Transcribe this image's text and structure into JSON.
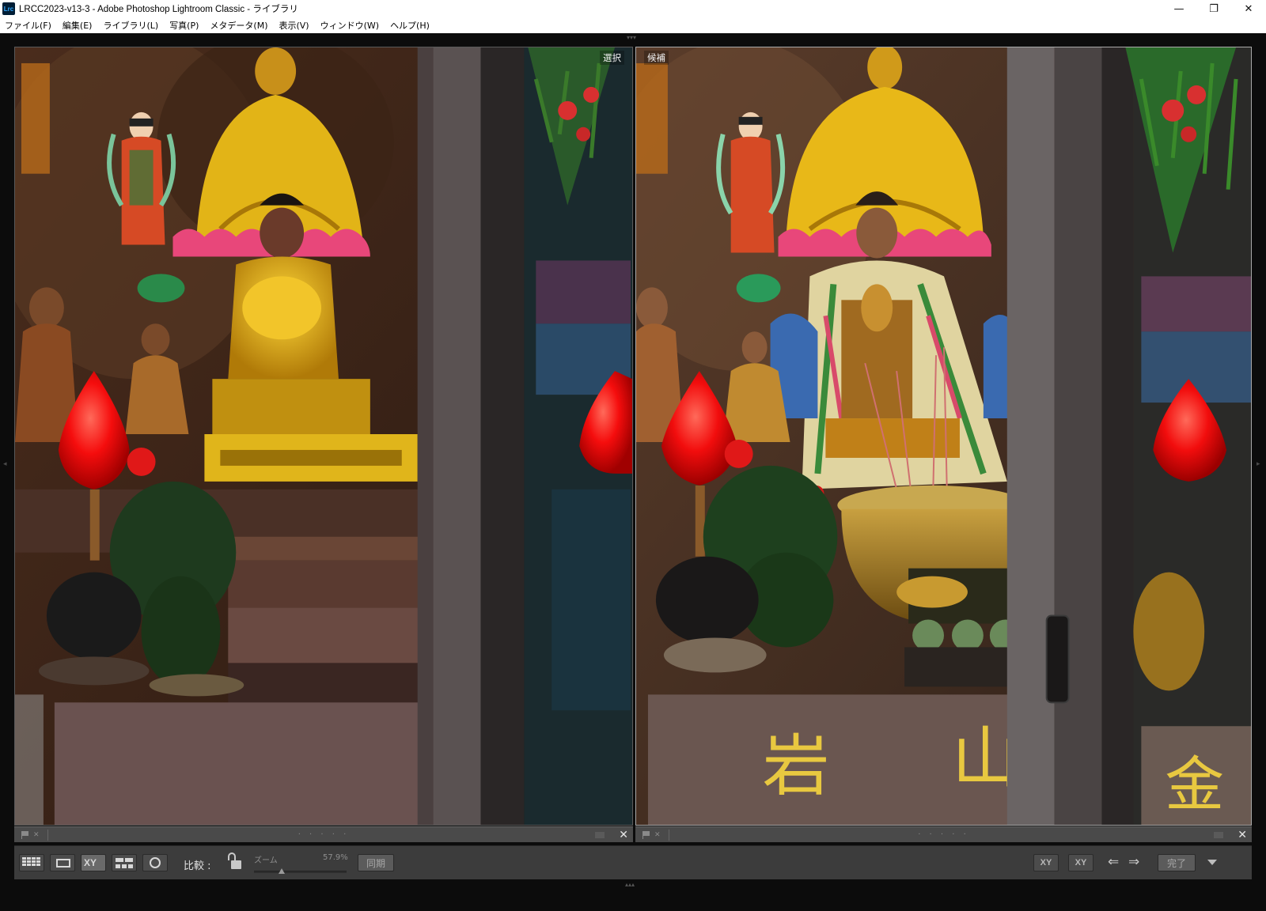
{
  "window": {
    "app_icon_text": "Lrc",
    "title": "LRCC2023-v13-3 - Adobe Photoshop Lightroom Classic - ライブラリ",
    "minimize": "—",
    "maximize": "❐",
    "close": "✕"
  },
  "menu": [
    "ファイル(F)",
    "編集(E)",
    "ライブラリ(L)",
    "写真(P)",
    "メタデータ(M)",
    "表示(V)",
    "ウィンドウ(W)",
    "ヘルプ(H)"
  ],
  "panels": {
    "left": {
      "label": "選択"
    },
    "right": {
      "label": "候補"
    }
  },
  "infostrip": {
    "reject": "✕",
    "dots": "· · · · ·",
    "close": "✕"
  },
  "toolbar": {
    "compare_label": "比較 :",
    "xy_label": "XY",
    "zoom_label": "ズーム",
    "zoom_value": "57.9%",
    "zoom_fraction": 0.3,
    "sync_label": "同期",
    "swap_label": "XY",
    "make_select_label": "XY",
    "prev_arrow": "⇐",
    "next_arrow": "⇒",
    "done_label": "完了"
  },
  "photo_text": {
    "right_char_1": "岩",
    "right_char_2": "山",
    "right_char_3": "金"
  },
  "icons": [
    "grid-view-icon",
    "loupe-view-icon",
    "compare-view-icon",
    "survey-view-icon",
    "people-view-icon",
    "lock-icon",
    "swap-icon",
    "make-select-icon",
    "prev-arrow-icon",
    "next-arrow-icon",
    "dropdown-icon"
  ]
}
